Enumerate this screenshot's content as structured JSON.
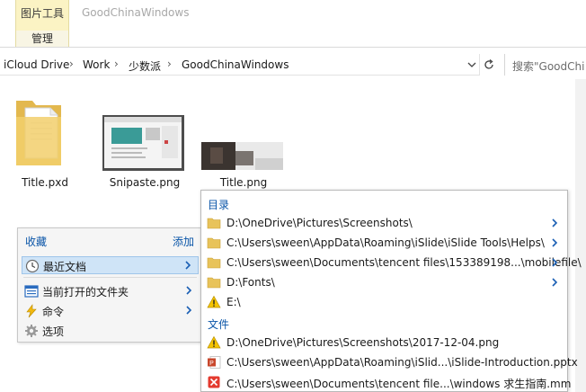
{
  "ribbon": {
    "context_tab_title": "图片工具",
    "context_tab_sub": "管理",
    "window_title": "GoodChinaWindows"
  },
  "address": {
    "crumbs": [
      "iCloud Drive",
      "Work",
      "少数派",
      "GoodChinaWindows"
    ]
  },
  "search": {
    "placeholder": "搜索\"GoodChi"
  },
  "files": [
    {
      "name": "Title.pxd",
      "icon": "folder-document-icon"
    },
    {
      "name": "Snipaste.png",
      "icon": "image-thumbnail"
    },
    {
      "name": "Title.png",
      "icon": "image-thumbnail"
    }
  ],
  "left_menu": {
    "header": "收藏",
    "add": "添加",
    "items": [
      {
        "label": "最近文档",
        "icon": "clock-icon",
        "has_submenu": true,
        "active": true
      },
      {
        "label": "当前打开的文件夹",
        "icon": "window-list-icon",
        "has_submenu": true
      },
      {
        "label": "命令",
        "icon": "lightning-icon",
        "has_submenu": true
      },
      {
        "label": "选项",
        "icon": "gear-icon",
        "has_submenu": false
      }
    ]
  },
  "right_menu": {
    "section_dirs": "目录",
    "section_files": "文件",
    "dirs": [
      {
        "path": "D:\\OneDrive\\Pictures\\Screenshots\\",
        "icon": "folder-icon"
      },
      {
        "path": "C:\\Users\\sween\\AppData\\Roaming\\iSlide\\iSlide Tools\\Helps\\",
        "icon": "folder-icon"
      },
      {
        "path": "C:\\Users\\sween\\Documents\\tencent files\\153389198...\\mobilefile\\",
        "icon": "folder-icon"
      },
      {
        "path": "D:\\Fonts\\",
        "icon": "folder-icon"
      },
      {
        "path": "E:\\",
        "icon": "warning-icon"
      }
    ],
    "files": [
      {
        "path": "D:\\OneDrive\\Pictures\\Screenshots\\2017-12-04.png",
        "icon": "warning-icon"
      },
      {
        "path": "C:\\Users\\sween\\AppData\\Roaming\\iSlid...\\iSlide-Introduction.pptx",
        "icon": "powerpoint-icon"
      },
      {
        "path": "C:\\Users\\sween\\Documents\\tencent file...\\windows 求生指南.mm",
        "icon": "mindmap-icon"
      }
    ]
  },
  "colors": {
    "context_tab_bg": "#fbf3c4",
    "accent_blue": "#0a55a8",
    "menu_hover": "#cfe4f7",
    "folder": "#e8c35a"
  }
}
